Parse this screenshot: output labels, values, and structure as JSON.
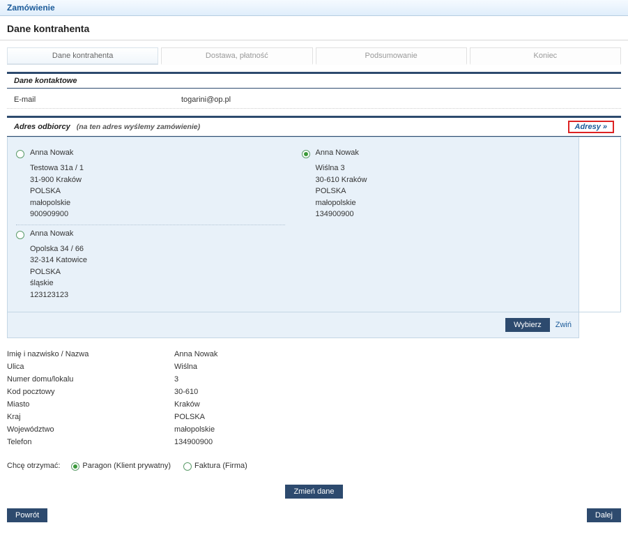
{
  "header": {
    "title": "Zamówienie"
  },
  "page_title": "Dane kontrahenta",
  "tabs": [
    {
      "label": "Dane kontrahenta",
      "active": true
    },
    {
      "label": "Dostawa, płatność",
      "active": false
    },
    {
      "label": "Podsumowanie",
      "active": false
    },
    {
      "label": "Koniec",
      "active": false
    }
  ],
  "section_contact": {
    "title": "Dane kontaktowe",
    "email_label": "E-mail",
    "email_value": "togarini@op.pl"
  },
  "section_recipient": {
    "title": "Adres odbiorcy",
    "hint": "(na ten adres wyślemy zamówienie)",
    "adresy_button": "Adresy »"
  },
  "addresses": [
    {
      "name": "Anna Nowak",
      "lines": [
        "Testowa 31a / 1",
        "31-900 Kraków",
        "POLSKA",
        "małopolskie",
        "900909900"
      ],
      "selected": false
    },
    {
      "name": "Anna Nowak",
      "lines": [
        "Wiślna 3",
        "30-610 Kraków",
        "POLSKA",
        "małopolskie",
        "134900900"
      ],
      "selected": true
    },
    {
      "name": "Anna Nowak",
      "lines": [
        "Opolska 34 / 66",
        "32-314 Katowice",
        "POLSKA",
        "śląskie",
        "123123123"
      ],
      "selected": false
    }
  ],
  "panel_actions": {
    "select": "Wybierz",
    "collapse": "Zwiń"
  },
  "details": {
    "rows": [
      {
        "k": "Imię i nazwisko / Nazwa",
        "v": "Anna Nowak"
      },
      {
        "k": "Ulica",
        "v": "Wiślna"
      },
      {
        "k": "Numer domu/lokalu",
        "v": "3"
      },
      {
        "k": "Kod pocztowy",
        "v": "30-610"
      },
      {
        "k": "Miasto",
        "v": "Kraków"
      },
      {
        "k": "Kraj",
        "v": "POLSKA"
      },
      {
        "k": "Województwo",
        "v": "małopolskie"
      },
      {
        "k": "Telefon",
        "v": "134900900"
      }
    ]
  },
  "receipt": {
    "label": "Chcę otrzymać:",
    "options": [
      {
        "label": "Paragon (Klient prywatny)",
        "selected": true
      },
      {
        "label": "Faktura (Firma)",
        "selected": false
      }
    ]
  },
  "buttons": {
    "change": "Zmień dane",
    "back": "Powrót",
    "next": "Dalej"
  }
}
